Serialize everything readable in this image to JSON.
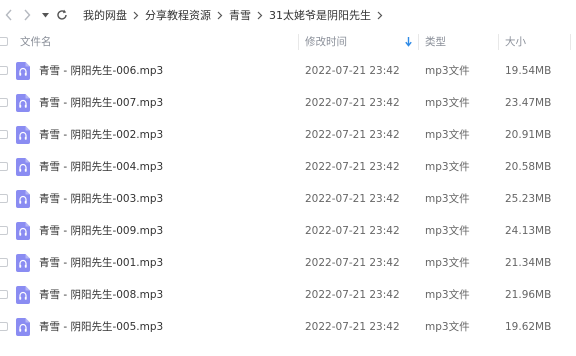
{
  "nav": {
    "back_icon": "chevron-left-icon",
    "forward_icon": "chevron-right-icon",
    "history_icon": "caret-down-icon",
    "refresh_icon": "refresh-icon",
    "breadcrumb": [
      "我的网盘",
      "分享教程资源",
      "青雪",
      "31太姥爷是阴阳先生"
    ]
  },
  "columns": {
    "name": "文件名",
    "modified": "修改时间",
    "type": "类型",
    "size": "大小",
    "sort_icon": "arrow-down-icon"
  },
  "files": [
    {
      "name": "青雪 - 阴阳先生-006.mp3",
      "modified": "2022-07-21 23:42",
      "type": "mp3文件",
      "size": "19.54MB"
    },
    {
      "name": "青雪 - 阴阳先生-007.mp3",
      "modified": "2022-07-21 23:42",
      "type": "mp3文件",
      "size": "23.47MB"
    },
    {
      "name": "青雪 - 阴阳先生-002.mp3",
      "modified": "2022-07-21 23:42",
      "type": "mp3文件",
      "size": "20.91MB"
    },
    {
      "name": "青雪 - 阴阳先生-004.mp3",
      "modified": "2022-07-21 23:42",
      "type": "mp3文件",
      "size": "20.58MB"
    },
    {
      "name": "青雪 - 阴阳先生-003.mp3",
      "modified": "2022-07-21 23:42",
      "type": "mp3文件",
      "size": "25.23MB"
    },
    {
      "name": "青雪 - 阴阳先生-009.mp3",
      "modified": "2022-07-21 23:42",
      "type": "mp3文件",
      "size": "24.13MB"
    },
    {
      "name": "青雪 - 阴阳先生-001.mp3",
      "modified": "2022-07-21 23:42",
      "type": "mp3文件",
      "size": "21.34MB"
    },
    {
      "name": "青雪 - 阴阳先生-008.mp3",
      "modified": "2022-07-21 23:42",
      "type": "mp3文件",
      "size": "21.96MB"
    },
    {
      "name": "青雪 - 阴阳先生-005.mp3",
      "modified": "2022-07-21 23:42",
      "type": "mp3文件",
      "size": "19.62MB"
    }
  ],
  "colors": {
    "audio_icon": "#8a8cf2",
    "sort_arrow": "#2e8ae6",
    "text": "#333333",
    "muted_text": "#666666",
    "header_text": "#8a8f99"
  }
}
